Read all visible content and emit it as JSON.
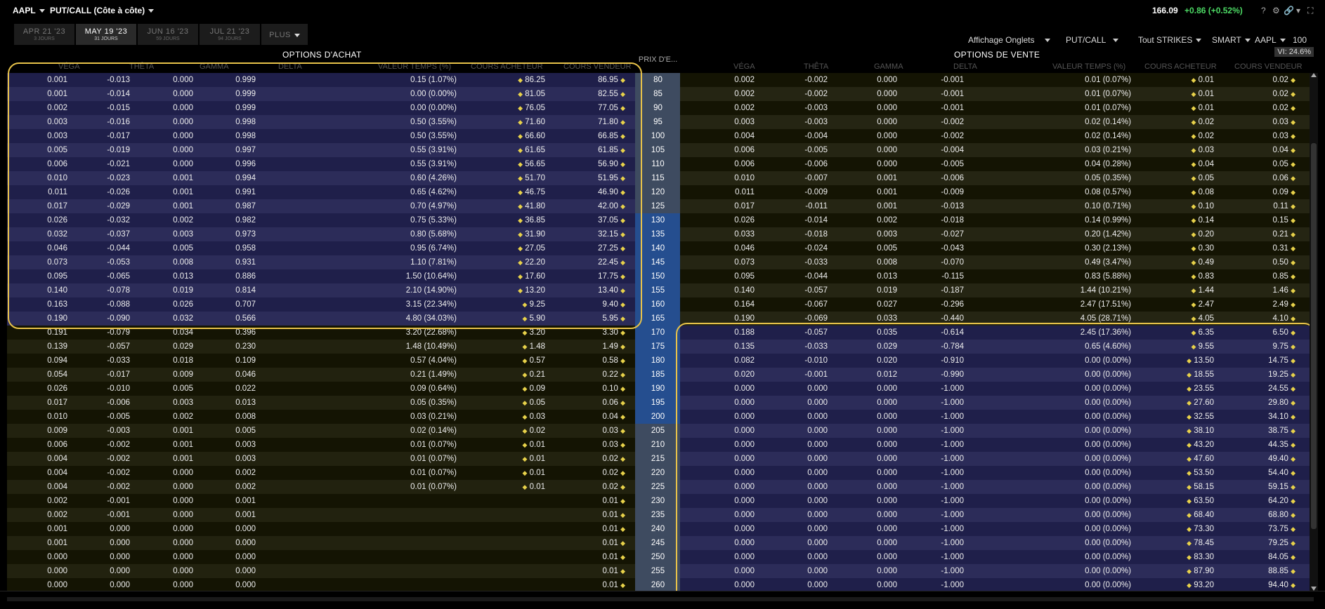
{
  "topbar": {
    "symbol": "AAPL",
    "view": "PUT/CALL (Côte à côte)",
    "last_price": "166.09",
    "change": "+0.86 (+0.52%)",
    "icons": [
      "help-icon",
      "gear-icon",
      "link-icon",
      "chevron-down-icon",
      "expand-icon"
    ]
  },
  "tabs": [
    {
      "label": "APR 21 '23",
      "sub": "3 JOURS",
      "active": false
    },
    {
      "label": "MAY 19 '23",
      "sub": "31 JOURS",
      "active": true
    },
    {
      "label": "JUN 16 '23",
      "sub": "59 JOURS",
      "active": false
    },
    {
      "label": "JUL 21 '23",
      "sub": "94 JOURS",
      "active": false
    },
    {
      "label": "PLUS",
      "sub": "",
      "active": false
    }
  ],
  "settings": {
    "affichage": "Affichage Onglets",
    "putcall": "PUT/CALL",
    "strikes": "Tout STRIKES",
    "exchange": "SMART",
    "underlying": "AAPL",
    "multiplier": "100"
  },
  "headers": {
    "calls_title": "OPTIONS D'ACHAT",
    "puts_title": "OPTIONS DE VENTE",
    "strike": "PRIX D'E...",
    "vi": "VI: 24.6%",
    "columns": [
      "VÉGA",
      "THÊTA",
      "GAMMA",
      "DELTA",
      "VALEUR TEMPS (%)",
      "COURS ACHETEUR",
      "COURS VENDEUR"
    ]
  },
  "strikes": [
    "80",
    "85",
    "90",
    "95",
    "100",
    "105",
    "110",
    "115",
    "120",
    "125",
    "130",
    "135",
    "140",
    "145",
    "150",
    "155",
    "160",
    "165",
    "170",
    "175",
    "180",
    "185",
    "190",
    "195",
    "200",
    "205",
    "210",
    "215",
    "220",
    "225",
    "230",
    "235",
    "240",
    "245",
    "250",
    "255",
    "260"
  ],
  "calls": [
    {
      "vega": "0.001",
      "theta": "-0.013",
      "gamma": "0.000",
      "delta": "0.999",
      "tv": "0.15 (1.07%)",
      "bid": "86.25",
      "ask": "86.95"
    },
    {
      "vega": "0.001",
      "theta": "-0.014",
      "gamma": "0.000",
      "delta": "0.999",
      "tv": "0.00 (0.00%)",
      "bid": "81.05",
      "ask": "82.55"
    },
    {
      "vega": "0.002",
      "theta": "-0.015",
      "gamma": "0.000",
      "delta": "0.999",
      "tv": "0.00 (0.00%)",
      "bid": "76.05",
      "ask": "77.05"
    },
    {
      "vega": "0.003",
      "theta": "-0.016",
      "gamma": "0.000",
      "delta": "0.998",
      "tv": "0.50 (3.55%)",
      "bid": "71.60",
      "ask": "71.80"
    },
    {
      "vega": "0.003",
      "theta": "-0.017",
      "gamma": "0.000",
      "delta": "0.998",
      "tv": "0.50 (3.55%)",
      "bid": "66.60",
      "ask": "66.85"
    },
    {
      "vega": "0.005",
      "theta": "-0.019",
      "gamma": "0.000",
      "delta": "0.997",
      "tv": "0.55 (3.91%)",
      "bid": "61.65",
      "ask": "61.85"
    },
    {
      "vega": "0.006",
      "theta": "-0.021",
      "gamma": "0.000",
      "delta": "0.996",
      "tv": "0.55 (3.91%)",
      "bid": "56.65",
      "ask": "56.90"
    },
    {
      "vega": "0.010",
      "theta": "-0.023",
      "gamma": "0.001",
      "delta": "0.994",
      "tv": "0.60 (4.26%)",
      "bid": "51.70",
      "ask": "51.95"
    },
    {
      "vega": "0.011",
      "theta": "-0.026",
      "gamma": "0.001",
      "delta": "0.991",
      "tv": "0.65 (4.62%)",
      "bid": "46.75",
      "ask": "46.90"
    },
    {
      "vega": "0.017",
      "theta": "-0.029",
      "gamma": "0.001",
      "delta": "0.987",
      "tv": "0.70 (4.97%)",
      "bid": "41.80",
      "ask": "42.00"
    },
    {
      "vega": "0.026",
      "theta": "-0.032",
      "gamma": "0.002",
      "delta": "0.982",
      "tv": "0.75 (5.33%)",
      "bid": "36.85",
      "ask": "37.05"
    },
    {
      "vega": "0.032",
      "theta": "-0.037",
      "gamma": "0.003",
      "delta": "0.973",
      "tv": "0.80 (5.68%)",
      "bid": "31.90",
      "ask": "32.15"
    },
    {
      "vega": "0.046",
      "theta": "-0.044",
      "gamma": "0.005",
      "delta": "0.958",
      "tv": "0.95 (6.74%)",
      "bid": "27.05",
      "ask": "27.25"
    },
    {
      "vega": "0.073",
      "theta": "-0.053",
      "gamma": "0.008",
      "delta": "0.931",
      "tv": "1.10 (7.81%)",
      "bid": "22.20",
      "ask": "22.45"
    },
    {
      "vega": "0.095",
      "theta": "-0.065",
      "gamma": "0.013",
      "delta": "0.886",
      "tv": "1.50 (10.64%)",
      "bid": "17.60",
      "ask": "17.75"
    },
    {
      "vega": "0.140",
      "theta": "-0.078",
      "gamma": "0.019",
      "delta": "0.814",
      "tv": "2.10 (14.90%)",
      "bid": "13.20",
      "ask": "13.40"
    },
    {
      "vega": "0.163",
      "theta": "-0.088",
      "gamma": "0.026",
      "delta": "0.707",
      "tv": "3.15 (22.34%)",
      "bid": "9.25",
      "ask": "9.40"
    },
    {
      "vega": "0.190",
      "theta": "-0.090",
      "gamma": "0.032",
      "delta": "0.566",
      "tv": "4.80 (34.03%)",
      "bid": "5.90",
      "ask": "5.95"
    },
    {
      "vega": "0.191",
      "theta": "-0.079",
      "gamma": "0.034",
      "delta": "0.396",
      "tv": "3.20 (22.68%)",
      "bid": "3.20",
      "ask": "3.30"
    },
    {
      "vega": "0.139",
      "theta": "-0.057",
      "gamma": "0.029",
      "delta": "0.230",
      "tv": "1.48 (10.49%)",
      "bid": "1.48",
      "ask": "1.49"
    },
    {
      "vega": "0.094",
      "theta": "-0.033",
      "gamma": "0.018",
      "delta": "0.109",
      "tv": "0.57 (4.04%)",
      "bid": "0.57",
      "ask": "0.58"
    },
    {
      "vega": "0.054",
      "theta": "-0.017",
      "gamma": "0.009",
      "delta": "0.046",
      "tv": "0.21 (1.49%)",
      "bid": "0.21",
      "ask": "0.22"
    },
    {
      "vega": "0.026",
      "theta": "-0.010",
      "gamma": "0.005",
      "delta": "0.022",
      "tv": "0.09 (0.64%)",
      "bid": "0.09",
      "ask": "0.10"
    },
    {
      "vega": "0.017",
      "theta": "-0.006",
      "gamma": "0.003",
      "delta": "0.013",
      "tv": "0.05 (0.35%)",
      "bid": "0.05",
      "ask": "0.06"
    },
    {
      "vega": "0.010",
      "theta": "-0.005",
      "gamma": "0.002",
      "delta": "0.008",
      "tv": "0.03 (0.21%)",
      "bid": "0.03",
      "ask": "0.04"
    },
    {
      "vega": "0.009",
      "theta": "-0.003",
      "gamma": "0.001",
      "delta": "0.005",
      "tv": "0.02 (0.14%)",
      "bid": "0.02",
      "ask": "0.03"
    },
    {
      "vega": "0.006",
      "theta": "-0.002",
      "gamma": "0.001",
      "delta": "0.003",
      "tv": "0.01 (0.07%)",
      "bid": "0.01",
      "ask": "0.03"
    },
    {
      "vega": "0.004",
      "theta": "-0.002",
      "gamma": "0.001",
      "delta": "0.003",
      "tv": "0.01 (0.07%)",
      "bid": "0.01",
      "ask": "0.02"
    },
    {
      "vega": "0.004",
      "theta": "-0.002",
      "gamma": "0.000",
      "delta": "0.002",
      "tv": "0.01 (0.07%)",
      "bid": "0.01",
      "ask": "0.02"
    },
    {
      "vega": "0.004",
      "theta": "-0.002",
      "gamma": "0.000",
      "delta": "0.002",
      "tv": "0.01 (0.07%)",
      "bid": "0.01",
      "ask": "0.02"
    },
    {
      "vega": "0.002",
      "theta": "-0.001",
      "gamma": "0.000",
      "delta": "0.001",
      "tv": "",
      "bid": "",
      "ask": "0.01"
    },
    {
      "vega": "0.002",
      "theta": "-0.001",
      "gamma": "0.000",
      "delta": "0.001",
      "tv": "",
      "bid": "",
      "ask": "0.01"
    },
    {
      "vega": "0.001",
      "theta": "0.000",
      "gamma": "0.000",
      "delta": "0.000",
      "tv": "",
      "bid": "",
      "ask": "0.01"
    },
    {
      "vega": "0.001",
      "theta": "0.000",
      "gamma": "0.000",
      "delta": "0.000",
      "tv": "",
      "bid": "",
      "ask": "0.01"
    },
    {
      "vega": "0.000",
      "theta": "0.000",
      "gamma": "0.000",
      "delta": "0.000",
      "tv": "",
      "bid": "",
      "ask": "0.01"
    },
    {
      "vega": "0.000",
      "theta": "0.000",
      "gamma": "0.000",
      "delta": "0.000",
      "tv": "",
      "bid": "",
      "ask": "0.01"
    },
    {
      "vega": "0.000",
      "theta": "0.000",
      "gamma": "0.000",
      "delta": "0.000",
      "tv": "",
      "bid": "",
      "ask": "0.01"
    }
  ],
  "puts": [
    {
      "vega": "0.002",
      "theta": "-0.002",
      "gamma": "0.000",
      "delta": "-0.001",
      "tv": "0.01 (0.07%)",
      "bid": "0.01",
      "ask": "0.02"
    },
    {
      "vega": "0.002",
      "theta": "-0.002",
      "gamma": "0.000",
      "delta": "-0.001",
      "tv": "0.01 (0.07%)",
      "bid": "0.01",
      "ask": "0.02"
    },
    {
      "vega": "0.002",
      "theta": "-0.003",
      "gamma": "0.000",
      "delta": "-0.001",
      "tv": "0.01 (0.07%)",
      "bid": "0.01",
      "ask": "0.02"
    },
    {
      "vega": "0.003",
      "theta": "-0.003",
      "gamma": "0.000",
      "delta": "-0.002",
      "tv": "0.02 (0.14%)",
      "bid": "0.02",
      "ask": "0.03"
    },
    {
      "vega": "0.004",
      "theta": "-0.004",
      "gamma": "0.000",
      "delta": "-0.002",
      "tv": "0.02 (0.14%)",
      "bid": "0.02",
      "ask": "0.03"
    },
    {
      "vega": "0.006",
      "theta": "-0.005",
      "gamma": "0.000",
      "delta": "-0.004",
      "tv": "0.03 (0.21%)",
      "bid": "0.03",
      "ask": "0.04"
    },
    {
      "vega": "0.006",
      "theta": "-0.006",
      "gamma": "0.000",
      "delta": "-0.005",
      "tv": "0.04 (0.28%)",
      "bid": "0.04",
      "ask": "0.05"
    },
    {
      "vega": "0.010",
      "theta": "-0.007",
      "gamma": "0.001",
      "delta": "-0.006",
      "tv": "0.05 (0.35%)",
      "bid": "0.05",
      "ask": "0.06"
    },
    {
      "vega": "0.011",
      "theta": "-0.009",
      "gamma": "0.001",
      "delta": "-0.009",
      "tv": "0.08 (0.57%)",
      "bid": "0.08",
      "ask": "0.09"
    },
    {
      "vega": "0.017",
      "theta": "-0.011",
      "gamma": "0.001",
      "delta": "-0.013",
      "tv": "0.10 (0.71%)",
      "bid": "0.10",
      "ask": "0.11"
    },
    {
      "vega": "0.026",
      "theta": "-0.014",
      "gamma": "0.002",
      "delta": "-0.018",
      "tv": "0.14 (0.99%)",
      "bid": "0.14",
      "ask": "0.15"
    },
    {
      "vega": "0.033",
      "theta": "-0.018",
      "gamma": "0.003",
      "delta": "-0.027",
      "tv": "0.20 (1.42%)",
      "bid": "0.20",
      "ask": "0.21"
    },
    {
      "vega": "0.046",
      "theta": "-0.024",
      "gamma": "0.005",
      "delta": "-0.043",
      "tv": "0.30 (2.13%)",
      "bid": "0.30",
      "ask": "0.31"
    },
    {
      "vega": "0.073",
      "theta": "-0.033",
      "gamma": "0.008",
      "delta": "-0.070",
      "tv": "0.49 (3.47%)",
      "bid": "0.49",
      "ask": "0.50"
    },
    {
      "vega": "0.095",
      "theta": "-0.044",
      "gamma": "0.013",
      "delta": "-0.115",
      "tv": "0.83 (5.88%)",
      "bid": "0.83",
      "ask": "0.85"
    },
    {
      "vega": "0.140",
      "theta": "-0.057",
      "gamma": "0.019",
      "delta": "-0.187",
      "tv": "1.44 (10.21%)",
      "bid": "1.44",
      "ask": "1.46"
    },
    {
      "vega": "0.164",
      "theta": "-0.067",
      "gamma": "0.027",
      "delta": "-0.296",
      "tv": "2.47 (17.51%)",
      "bid": "2.47",
      "ask": "2.49"
    },
    {
      "vega": "0.190",
      "theta": "-0.069",
      "gamma": "0.033",
      "delta": "-0.440",
      "tv": "4.05 (28.71%)",
      "bid": "4.05",
      "ask": "4.10"
    },
    {
      "vega": "0.188",
      "theta": "-0.057",
      "gamma": "0.035",
      "delta": "-0.614",
      "tv": "2.45 (17.36%)",
      "bid": "6.35",
      "ask": "6.50"
    },
    {
      "vega": "0.135",
      "theta": "-0.033",
      "gamma": "0.029",
      "delta": "-0.784",
      "tv": "0.65 (4.60%)",
      "bid": "9.55",
      "ask": "9.75"
    },
    {
      "vega": "0.082",
      "theta": "-0.010",
      "gamma": "0.020",
      "delta": "-0.910",
      "tv": "0.00 (0.00%)",
      "bid": "13.50",
      "ask": "14.75"
    },
    {
      "vega": "0.020",
      "theta": "-0.001",
      "gamma": "0.012",
      "delta": "-0.990",
      "tv": "0.00 (0.00%)",
      "bid": "18.55",
      "ask": "19.25"
    },
    {
      "vega": "0.000",
      "theta": "0.000",
      "gamma": "0.000",
      "delta": "-1.000",
      "tv": "0.00 (0.00%)",
      "bid": "23.55",
      "ask": "24.55"
    },
    {
      "vega": "0.000",
      "theta": "0.000",
      "gamma": "0.000",
      "delta": "-1.000",
      "tv": "0.00 (0.00%)",
      "bid": "27.60",
      "ask": "29.80"
    },
    {
      "vega": "0.000",
      "theta": "0.000",
      "gamma": "0.000",
      "delta": "-1.000",
      "tv": "0.00 (0.00%)",
      "bid": "32.55",
      "ask": "34.10"
    },
    {
      "vega": "0.000",
      "theta": "0.000",
      "gamma": "0.000",
      "delta": "-1.000",
      "tv": "0.00 (0.00%)",
      "bid": "38.10",
      "ask": "38.75"
    },
    {
      "vega": "0.000",
      "theta": "0.000",
      "gamma": "0.000",
      "delta": "-1.000",
      "tv": "0.00 (0.00%)",
      "bid": "43.20",
      "ask": "44.35"
    },
    {
      "vega": "0.000",
      "theta": "0.000",
      "gamma": "0.000",
      "delta": "-1.000",
      "tv": "0.00 (0.00%)",
      "bid": "47.60",
      "ask": "49.40"
    },
    {
      "vega": "0.000",
      "theta": "0.000",
      "gamma": "0.000",
      "delta": "-1.000",
      "tv": "0.00 (0.00%)",
      "bid": "53.50",
      "ask": "54.40"
    },
    {
      "vega": "0.000",
      "theta": "0.000",
      "gamma": "0.000",
      "delta": "-1.000",
      "tv": "0.00 (0.00%)",
      "bid": "58.15",
      "ask": "59.15"
    },
    {
      "vega": "0.000",
      "theta": "0.000",
      "gamma": "0.000",
      "delta": "-1.000",
      "tv": "0.00 (0.00%)",
      "bid": "63.50",
      "ask": "64.20"
    },
    {
      "vega": "0.000",
      "theta": "0.000",
      "gamma": "0.000",
      "delta": "-1.000",
      "tv": "0.00 (0.00%)",
      "bid": "68.40",
      "ask": "68.80"
    },
    {
      "vega": "0.000",
      "theta": "0.000",
      "gamma": "0.000",
      "delta": "-1.000",
      "tv": "0.00 (0.00%)",
      "bid": "73.30",
      "ask": "73.75"
    },
    {
      "vega": "0.000",
      "theta": "0.000",
      "gamma": "0.000",
      "delta": "-1.000",
      "tv": "0.00 (0.00%)",
      "bid": "78.45",
      "ask": "79.25"
    },
    {
      "vega": "0.000",
      "theta": "0.000",
      "gamma": "0.000",
      "delta": "-1.000",
      "tv": "0.00 (0.00%)",
      "bid": "83.30",
      "ask": "84.05"
    },
    {
      "vega": "0.000",
      "theta": "0.000",
      "gamma": "0.000",
      "delta": "-1.000",
      "tv": "0.00 (0.00%)",
      "bid": "87.90",
      "ask": "88.85"
    },
    {
      "vega": "0.000",
      "theta": "0.000",
      "gamma": "0.000",
      "delta": "-1.000",
      "tv": "0.00 (0.00%)",
      "bid": "93.20",
      "ask": "94.40"
    }
  ],
  "highlight_color": "#e8c34a"
}
